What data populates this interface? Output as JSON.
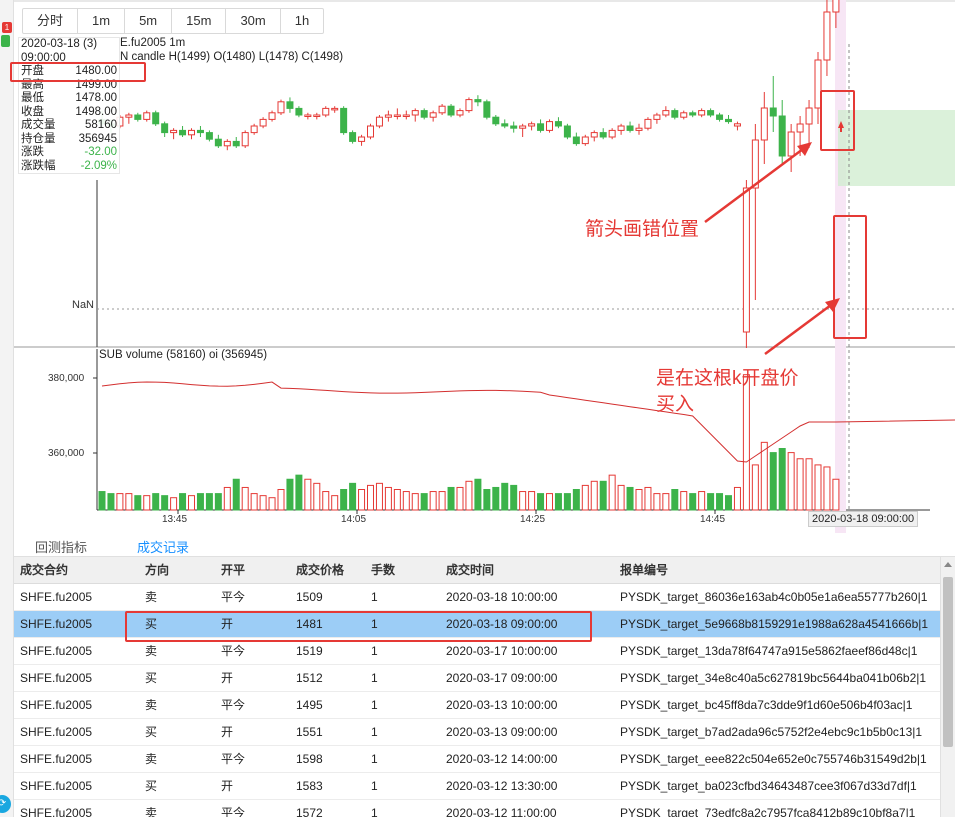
{
  "periods": [
    "分时",
    "1m",
    "5m",
    "15m",
    "30m",
    "1h"
  ],
  "left_badge": "1",
  "info": {
    "date": "2020-03-18 (3)",
    "time": "09:00:00",
    "rows": [
      {
        "label": "开盘",
        "value": "1480.00",
        "tone": ""
      },
      {
        "label": "最高",
        "value": "1499.00",
        "tone": ""
      },
      {
        "label": "最低",
        "value": "1478.00",
        "tone": ""
      },
      {
        "label": "收盘",
        "value": "1498.00",
        "tone": ""
      },
      {
        "label": "成交量",
        "value": "58160",
        "tone": ""
      },
      {
        "label": "持仓量",
        "value": "356945",
        "tone": ""
      },
      {
        "label": "涨跌",
        "value": "-32.00",
        "tone": "neg"
      },
      {
        "label": "涨跌幅",
        "value": "-2.09%",
        "tone": "neg"
      }
    ]
  },
  "chart": {
    "title": "E.fu2005 1m",
    "subtitle": "N candle H(1499) O(1480) L(1478) C(1498)",
    "nan_label": "NaN",
    "sub_title": "SUB volume (58160) oi (356945)",
    "y_ticks": [
      "380,000",
      "360,000"
    ],
    "x_ticks": [
      "13:45",
      "14:05",
      "14:25",
      "14:45"
    ],
    "x_highlight": "2020-03-18 09:00:00"
  },
  "chart_data": {
    "type": "candlestick",
    "x_ticks": [
      "13:45",
      "14:05",
      "14:25",
      "14:45"
    ],
    "candles_ohlc": [
      [
        1516,
        1520,
        1512,
        1514
      ],
      [
        1514,
        1516,
        1510,
        1513
      ],
      [
        1513,
        1518,
        1512,
        1517
      ],
      [
        1517,
        1519,
        1514,
        1518
      ],
      [
        1518,
        1519,
        1515,
        1516
      ],
      [
        1516,
        1520,
        1515,
        1519
      ],
      [
        1519,
        1520,
        1513,
        1514
      ],
      [
        1514,
        1515,
        1508,
        1510
      ],
      [
        1510,
        1512,
        1507,
        1511
      ],
      [
        1511,
        1513,
        1508,
        1509
      ],
      [
        1509,
        1512,
        1507,
        1511
      ],
      [
        1511,
        1513,
        1508,
        1510
      ],
      [
        1510,
        1511,
        1506,
        1507
      ],
      [
        1507,
        1509,
        1503,
        1504
      ],
      [
        1504,
        1507,
        1502,
        1506
      ],
      [
        1506,
        1508,
        1503,
        1504
      ],
      [
        1504,
        1511,
        1503,
        1510
      ],
      [
        1510,
        1514,
        1509,
        1513
      ],
      [
        1513,
        1517,
        1512,
        1516
      ],
      [
        1516,
        1520,
        1515,
        1519
      ],
      [
        1519,
        1525,
        1518,
        1524
      ],
      [
        1524,
        1526,
        1519,
        1521
      ],
      [
        1521,
        1522,
        1517,
        1518
      ],
      [
        1518,
        1519,
        1516,
        1518
      ],
      [
        1518,
        1519,
        1516,
        1518
      ],
      [
        1518,
        1522,
        1517,
        1521
      ],
      [
        1521,
        1522,
        1519,
        1521
      ],
      [
        1521,
        1522,
        1509,
        1510
      ],
      [
        1510,
        1511,
        1505,
        1506
      ],
      [
        1506,
        1509,
        1504,
        1508
      ],
      [
        1508,
        1514,
        1507,
        1513
      ],
      [
        1513,
        1518,
        1512,
        1517
      ],
      [
        1517,
        1520,
        1515,
        1518
      ],
      [
        1518,
        1521,
        1516,
        1518
      ],
      [
        1518,
        1520,
        1516,
        1518
      ],
      [
        1518,
        1521,
        1515,
        1520
      ],
      [
        1520,
        1521,
        1516,
        1517
      ],
      [
        1517,
        1520,
        1515,
        1519
      ],
      [
        1519,
        1523,
        1518,
        1522
      ],
      [
        1522,
        1523,
        1517,
        1518
      ],
      [
        1518,
        1521,
        1517,
        1520
      ],
      [
        1520,
        1526,
        1519,
        1525
      ],
      [
        1525,
        1527,
        1522,
        1524
      ],
      [
        1524,
        1525,
        1516,
        1517
      ],
      [
        1517,
        1518,
        1513,
        1514
      ],
      [
        1514,
        1516,
        1512,
        1513
      ],
      [
        1513,
        1515,
        1510,
        1512
      ],
      [
        1512,
        1514,
        1508,
        1513
      ],
      [
        1513,
        1515,
        1511,
        1514
      ],
      [
        1514,
        1516,
        1510,
        1511
      ],
      [
        1511,
        1516,
        1510,
        1515
      ],
      [
        1515,
        1517,
        1512,
        1513
      ],
      [
        1513,
        1514,
        1507,
        1508
      ],
      [
        1508,
        1510,
        1504,
        1505
      ],
      [
        1505,
        1509,
        1504,
        1508
      ],
      [
        1508,
        1511,
        1506,
        1510
      ],
      [
        1510,
        1512,
        1507,
        1508
      ],
      [
        1508,
        1512,
        1507,
        1511
      ],
      [
        1511,
        1514,
        1509,
        1513
      ],
      [
        1513,
        1515,
        1510,
        1511
      ],
      [
        1511,
        1514,
        1509,
        1512
      ],
      [
        1512,
        1517,
        1511,
        1516
      ],
      [
        1516,
        1519,
        1514,
        1518
      ],
      [
        1518,
        1522,
        1517,
        1520
      ],
      [
        1520,
        1521,
        1516,
        1517
      ],
      [
        1517,
        1520,
        1516,
        1519
      ],
      [
        1519,
        1520,
        1517,
        1518
      ],
      [
        1518,
        1521,
        1517,
        1520
      ],
      [
        1520,
        1521,
        1517,
        1518
      ],
      [
        1518,
        1519,
        1515,
        1516
      ],
      [
        1516,
        1518,
        1514,
        1515
      ],
      [
        1513,
        1515,
        1511,
        1514
      ],
      [
        1480,
        1499,
        1478,
        1498
      ],
      [
        1498,
        1506,
        1484,
        1504
      ],
      [
        1504,
        1510,
        1501,
        1508
      ],
      [
        1508,
        1512,
        1505,
        1507
      ],
      [
        1507,
        1509,
        1501,
        1502
      ],
      [
        1502,
        1506,
        1500,
        1505
      ],
      [
        1505,
        1507,
        1502,
        1506
      ],
      [
        1506,
        1509,
        1503,
        1508
      ],
      [
        1508,
        1515,
        1506,
        1514
      ],
      [
        1514,
        1522,
        1512,
        1520
      ],
      [
        1520,
        1526,
        1518,
        1524
      ]
    ],
    "volume": [
      9,
      8,
      8,
      8,
      7,
      7,
      8,
      7,
      6,
      8,
      7,
      8,
      8,
      8,
      11,
      15,
      11,
      8,
      7,
      6,
      10,
      15,
      17,
      15,
      13,
      9,
      7,
      10,
      13,
      10,
      12,
      13,
      11,
      10,
      9,
      8,
      8,
      9,
      9,
      11,
      11,
      14,
      15,
      10,
      11,
      13,
      12,
      9,
      9,
      8,
      8,
      8,
      8,
      10,
      12,
      14,
      14,
      17,
      12,
      11,
      10,
      11,
      8,
      8,
      10,
      9,
      8,
      9,
      8,
      8,
      7,
      11,
      66,
      22,
      33,
      28,
      30,
      28,
      25,
      25,
      22,
      21,
      15
    ],
    "oi_note": "red line on sub panel"
  },
  "tabs": [
    "回测指标",
    "成交记录"
  ],
  "table": {
    "headers": [
      "成交合约",
      "方向",
      "开平",
      "成交价格",
      "手数",
      "成交时间",
      "报单编号"
    ],
    "rows": [
      [
        "SHFE.fu2005",
        "卖",
        "平今",
        "1509",
        "1",
        "2020-03-18 10:00:00",
        "PYSDK_target_86036e163ab4c0b05e1a6ea55777b260|1"
      ],
      [
        "SHFE.fu2005",
        "买",
        "开",
        "1481",
        "1",
        "2020-03-18 09:00:00",
        "PYSDK_target_5e9668b8159291e1988a628a4541666b|1"
      ],
      [
        "SHFE.fu2005",
        "卖",
        "平今",
        "1519",
        "1",
        "2020-03-17 10:00:00",
        "PYSDK_target_13da78f64747a915e5862faeef86d48c|1"
      ],
      [
        "SHFE.fu2005",
        "买",
        "开",
        "1512",
        "1",
        "2020-03-17 09:00:00",
        "PYSDK_target_34e8c40a5c627819bc5644ba041b06b2|1"
      ],
      [
        "SHFE.fu2005",
        "卖",
        "平今",
        "1495",
        "1",
        "2020-03-13 10:00:00",
        "PYSDK_target_bc45ff8da7c3dde9f1d60e506b4f03ac|1"
      ],
      [
        "SHFE.fu2005",
        "买",
        "开",
        "1551",
        "1",
        "2020-03-13 09:00:00",
        "PYSDK_target_b7ad2ada96c5752f2e4ebc9c1b5b0c13|1"
      ],
      [
        "SHFE.fu2005",
        "卖",
        "平今",
        "1598",
        "1",
        "2020-03-12 14:00:00",
        "PYSDK_target_eee822c504e652e0c755746b31549d2b|1"
      ],
      [
        "SHFE.fu2005",
        "买",
        "开",
        "1583",
        "1",
        "2020-03-12 13:30:00",
        "PYSDK_target_ba023cfbd34643487cee3f067d33d7df|1"
      ],
      [
        "SHFE.fu2005",
        "卖",
        "平今",
        "1572",
        "1",
        "2020-03-12 11:00:00",
        "PYSDK_target_73edfc8a2c7957fca8412b89c10bf8a7|1"
      ]
    ],
    "selected_index": 1
  },
  "annotations": {
    "arrow_wrong": "箭头画错位置",
    "buy_at_open_1": "是在这根k开盘价",
    "buy_at_open_2": "买入"
  },
  "colors": {
    "up": "#e53935",
    "down": "#3cb34a",
    "oi": "#d32f2f",
    "accent": "#1890ff"
  }
}
